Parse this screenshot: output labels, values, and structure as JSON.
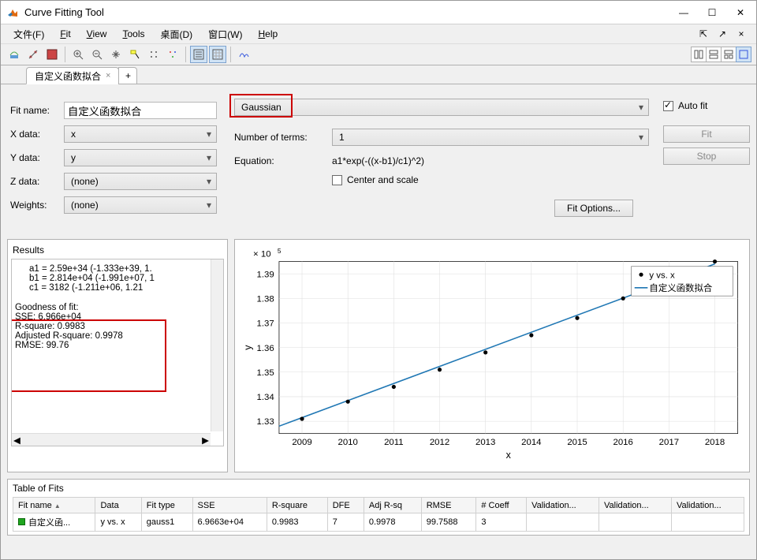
{
  "window": {
    "title": "Curve Fitting Tool"
  },
  "menu": {
    "file": "文件(F)",
    "fit": "Fit",
    "view": "View",
    "tools": "Tools",
    "desktop": "桌面(D)",
    "window": "窗口(W)",
    "help": "Help"
  },
  "tab": {
    "name": "自定义函数拟合",
    "close": "×",
    "plus": "+"
  },
  "form": {
    "fitname_label": "Fit name:",
    "fitname_value": "自定义函数拟合",
    "xdata_label": "X data:",
    "xdata_value": "x",
    "ydata_label": "Y data:",
    "ydata_value": "y",
    "zdata_label": "Z data:",
    "zdata_value": "(none)",
    "weights_label": "Weights:",
    "weights_value": "(none)"
  },
  "fittype": {
    "method": "Gaussian",
    "nterms_label": "Number of terms:",
    "nterms_value": "1",
    "equation_label": "Equation:",
    "equation_value": "a1*exp(-((x-b1)/c1)^2)",
    "center": "Center and scale",
    "fitoptions": "Fit Options..."
  },
  "right": {
    "autofit": "Auto fit",
    "fit": "Fit",
    "stop": "Stop"
  },
  "results": {
    "title": "Results",
    "line1": "a1 =   2.59e+34  (-1.333e+39, 1.",
    "line2": "b1 =  2.814e+04  (-1.991e+07, 1",
    "line3": "c1 =        3182  (-1.211e+06, 1.21",
    "gof_hdr": "Goodness of fit:",
    "sse": "  SSE: 6.966e+04",
    "r2": "  R-square: 0.9983",
    "ar2": "  Adjusted R-square: 0.9978",
    "rmse": "  RMSE: 99.76"
  },
  "chart_data": {
    "type": "scatter+line",
    "xlabel": "x",
    "ylabel": "y",
    "yscale": "× 10^5",
    "xticks": [
      2009,
      2010,
      2011,
      2012,
      2013,
      2014,
      2015,
      2016,
      2017,
      2018
    ],
    "yticks": [
      1.33,
      1.34,
      1.35,
      1.36,
      1.37,
      1.38,
      1.39
    ],
    "series": [
      {
        "name": "y vs. x",
        "type": "scatter",
        "marker": "dot",
        "color": "#000000",
        "x": [
          2009,
          2010,
          2011,
          2012,
          2013,
          2014,
          2015,
          2016,
          2017,
          2018
        ],
        "y": [
          1.331,
          1.338,
          1.344,
          1.351,
          1.358,
          1.365,
          1.372,
          1.38,
          1.388,
          1.395
        ]
      },
      {
        "name": "自定义函数拟合",
        "type": "line",
        "color": "#1f77b4",
        "x": [
          2008.5,
          2018
        ],
        "y": [
          1.328,
          1.394
        ]
      }
    ],
    "legend": {
      "pos": "top-right",
      "items": [
        "y vs. x",
        "自定义函数拟合"
      ]
    }
  },
  "table": {
    "title": "Table of Fits",
    "cols": [
      "Fit name",
      "Data",
      "Fit type",
      "SSE",
      "R-square",
      "DFE",
      "Adj R-sq",
      "RMSE",
      "# Coeff",
      "Validation...",
      "Validation...",
      "Validation..."
    ],
    "row": {
      "fitname": "自定义函...",
      "data": "y vs. x",
      "fittype": "gauss1",
      "sse": "6.9663e+04",
      "r2": "0.9983",
      "dfe": "7",
      "ar2": "0.9978",
      "rmse": "99.7588",
      "ncoeff": "3",
      "v1": "",
      "v2": "",
      "v3": ""
    }
  }
}
